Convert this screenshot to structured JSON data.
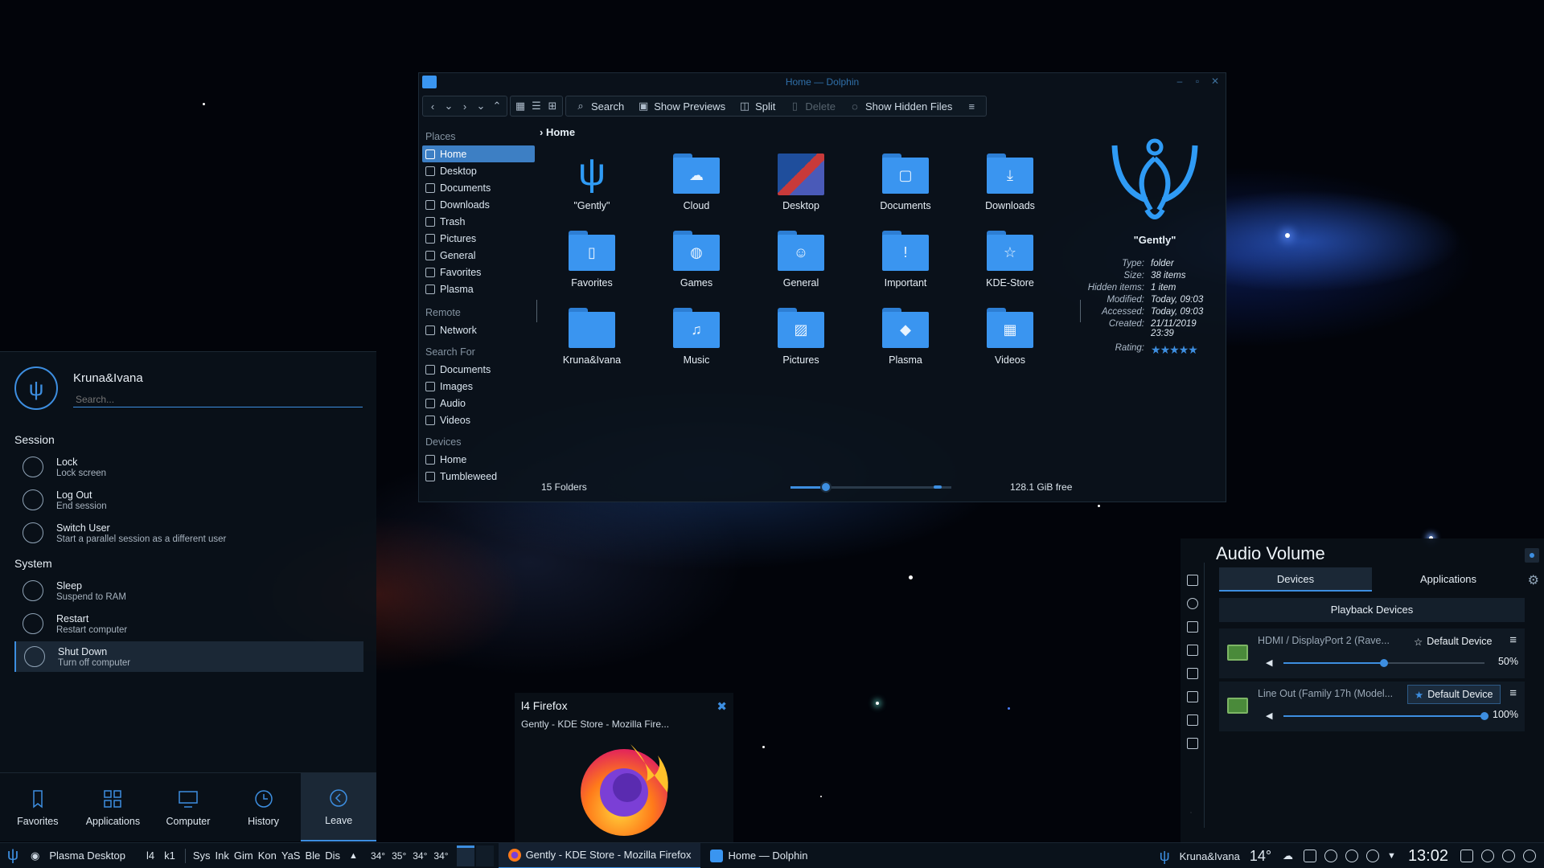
{
  "dolphin": {
    "title": "Home — Dolphin",
    "toolbar": {
      "search": "Search",
      "show_previews": "Show Previews",
      "split": "Split",
      "delete": "Delete",
      "show_hidden": "Show Hidden Files"
    },
    "places": {
      "header": "Places",
      "items": [
        "Home",
        "Desktop",
        "Documents",
        "Downloads",
        "Trash",
        "Pictures",
        "General",
        "Favorites",
        "Plasma"
      ],
      "remote_header": "Remote",
      "remote_items": [
        "Network"
      ],
      "search_header": "Search For",
      "search_items": [
        "Documents",
        "Images",
        "Audio",
        "Videos"
      ],
      "devices_header": "Devices",
      "devices_items": [
        "Home",
        "Tumbleweed"
      ]
    },
    "breadcrumb": "Home",
    "folders": [
      {
        "name": "\"Gently\"",
        "icon": "gently-logo-icon"
      },
      {
        "name": "Cloud",
        "icon": "cloud-icon"
      },
      {
        "name": "Desktop",
        "icon": "desktop-preview-icon"
      },
      {
        "name": "Documents",
        "icon": "document-icon"
      },
      {
        "name": "Downloads",
        "icon": "download-icon"
      },
      {
        "name": "Favorites",
        "icon": "bookmark-icon"
      },
      {
        "name": "Games",
        "icon": "gamepad-icon"
      },
      {
        "name": "General",
        "icon": "people-icon"
      },
      {
        "name": "Important",
        "icon": "exclamation-icon"
      },
      {
        "name": "KDE-Store",
        "icon": "star-icon"
      },
      {
        "name": "Kruna&Ivana",
        "icon": "folder-icon"
      },
      {
        "name": "Music",
        "icon": "music-icon"
      },
      {
        "name": "Pictures",
        "icon": "picture-icon"
      },
      {
        "name": "Plasma",
        "icon": "plasma-icon"
      },
      {
        "name": "Videos",
        "icon": "film-icon"
      }
    ],
    "info": {
      "name": "\"Gently\"",
      "type_label": "Type:",
      "type": "folder",
      "size_label": "Size:",
      "size": "38 items",
      "hidden_label": "Hidden items:",
      "hidden": "1 item",
      "modified_label": "Modified:",
      "modified": "Today, 09:03",
      "accessed_label": "Accessed:",
      "accessed": "Today, 09:03",
      "created_label": "Created:",
      "created": "21/11/2019 23:39",
      "rating_label": "Rating:",
      "rating": 5
    },
    "status": "15 Folders",
    "free_space": "128.1 GiB free",
    "zoom_level": 0.22
  },
  "kickoff": {
    "user": "Kruna&Ivana",
    "search_placeholder": "Search...",
    "session_header": "Session",
    "session_items": [
      {
        "title": "Lock",
        "sub": "Lock screen"
      },
      {
        "title": "Log Out",
        "sub": "End session"
      },
      {
        "title": "Switch User",
        "sub": "Start a parallel session as a different user"
      }
    ],
    "system_header": "System",
    "system_items": [
      {
        "title": "Sleep",
        "sub": "Suspend to RAM"
      },
      {
        "title": "Restart",
        "sub": "Restart computer"
      },
      {
        "title": "Shut Down",
        "sub": "Turn off computer"
      }
    ],
    "tabs": [
      "Favorites",
      "Applications",
      "Computer",
      "History",
      "Leave"
    ]
  },
  "firefox_tooltip": {
    "title": "l4 Firefox",
    "subtitle": "Gently - KDE Store - Mozilla Fire..."
  },
  "audio": {
    "title": "Audio Volume",
    "tabs": [
      "Devices",
      "Applications"
    ],
    "section": "Playback Devices",
    "devices": [
      {
        "name": "HDMI / DisplayPort 2 (Rave...",
        "default_label": "Default Device",
        "volume": "50%",
        "level": 0.5
      },
      {
        "name": "Line Out (Family 17h (Model...",
        "default_label": "Default Device",
        "volume": "100%",
        "level": 1.0
      }
    ]
  },
  "taskbar": {
    "desktop": "Plasma Desktop",
    "pager": [
      "l4",
      "k1"
    ],
    "quick": [
      "Sys",
      "Ink",
      "Gim",
      "Kon",
      "YaS",
      "Ble",
      "Dis"
    ],
    "temps": [
      "34°",
      "35°",
      "34°",
      "34°"
    ],
    "tasks": [
      "Gently - KDE Store - Mozilla Firefox",
      "Home — Dolphin"
    ],
    "user": "Kruna&Ivana",
    "weather": "14°",
    "clock": "13:02"
  },
  "colors": {
    "accent": "#3d8ee0",
    "folder": "#3a95f0",
    "panel": "#0a121b"
  }
}
